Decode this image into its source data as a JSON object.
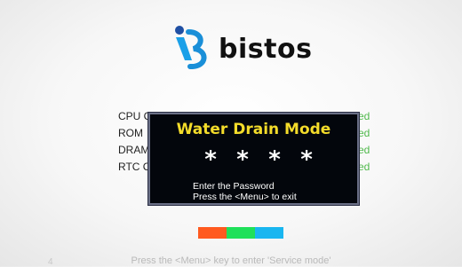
{
  "logo": {
    "text": "bistos"
  },
  "checks": [
    {
      "label": "CPU C",
      "status": "ed"
    },
    {
      "label": "ROM",
      "status": "ed"
    },
    {
      "label": "DRAM",
      "status": "ed"
    },
    {
      "label": "RTC C",
      "status": "ed"
    }
  ],
  "dialog": {
    "title": "Water Drain Mode",
    "password_mask": [
      "*",
      "*",
      "*",
      "*"
    ],
    "instruction_1": "Enter the Password",
    "instruction_2": "Press the <Menu> to exit"
  },
  "color_bar": [
    "#ff5a1f",
    "#1fe05a",
    "#19b6f0"
  ],
  "footer": {
    "number": "4",
    "text": "Press the <Menu> key to enter 'Service mode'"
  }
}
